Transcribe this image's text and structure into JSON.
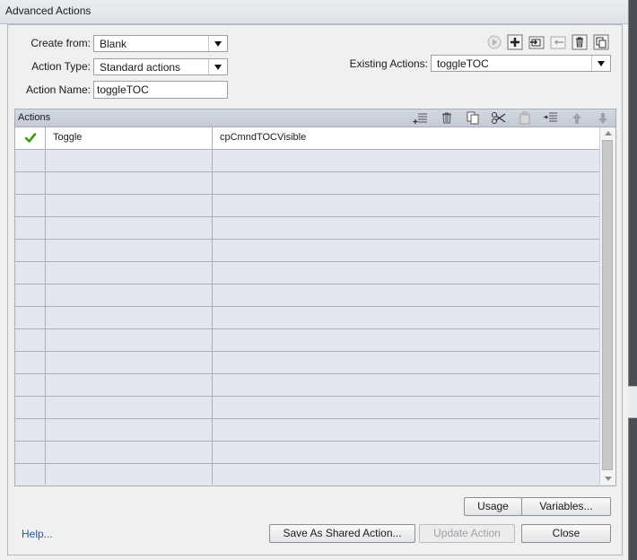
{
  "window": {
    "title": "Advanced Actions"
  },
  "form": {
    "create_from_label": "Create from:",
    "create_from_value": "Blank",
    "action_type_label": "Action Type:",
    "action_type_value": "Standard actions",
    "action_name_label": "Action Name:",
    "action_name_value": "toggleTOC",
    "existing_actions_label": "Existing Actions:",
    "existing_actions_value": "toggleTOC"
  },
  "top_toolbar": {
    "icons": [
      "preview-icon",
      "add-icon",
      "duplicate-icon",
      "import-icon",
      "delete-icon",
      "copy-icon"
    ]
  },
  "actions_panel": {
    "title": "Actions",
    "toolbar_icons": [
      "add-row-icon",
      "delete-row-icon",
      "copy-row-icon",
      "cut-icon",
      "paste-icon",
      "insert-row-icon",
      "move-up-icon",
      "move-down-icon"
    ],
    "rows": [
      {
        "status": "check",
        "action": "Toggle",
        "target": "cpCmndTOCVisible"
      },
      {
        "status": "",
        "action": "",
        "target": ""
      },
      {
        "status": "",
        "action": "",
        "target": ""
      },
      {
        "status": "",
        "action": "",
        "target": ""
      },
      {
        "status": "",
        "action": "",
        "target": ""
      },
      {
        "status": "",
        "action": "",
        "target": ""
      },
      {
        "status": "",
        "action": "",
        "target": ""
      },
      {
        "status": "",
        "action": "",
        "target": ""
      },
      {
        "status": "",
        "action": "",
        "target": ""
      },
      {
        "status": "",
        "action": "",
        "target": ""
      },
      {
        "status": "",
        "action": "",
        "target": ""
      },
      {
        "status": "",
        "action": "",
        "target": ""
      },
      {
        "status": "",
        "action": "",
        "target": ""
      },
      {
        "status": "",
        "action": "",
        "target": ""
      },
      {
        "status": "",
        "action": "",
        "target": ""
      },
      {
        "status": "",
        "action": "",
        "target": ""
      }
    ]
  },
  "buttons": {
    "usage": "Usage",
    "variables": "Variables...",
    "save_shared": "Save As Shared Action...",
    "update_action": "Update Action",
    "close": "Close"
  },
  "help_link": "Help...",
  "colors": {
    "check": "#3a9a1c",
    "link": "#1f5aa6",
    "panel_bg": "#e4e8ee"
  }
}
